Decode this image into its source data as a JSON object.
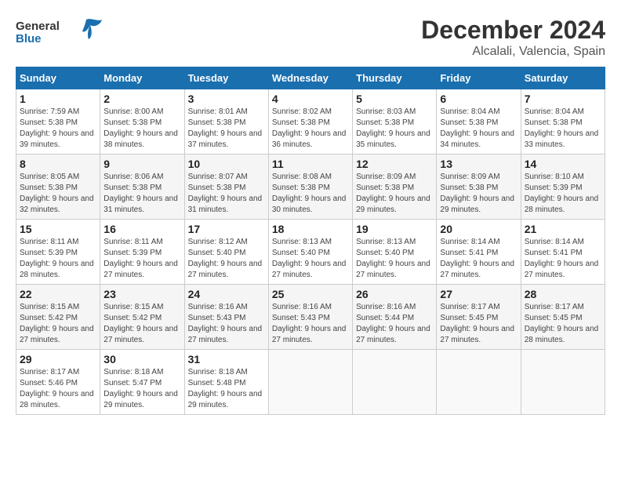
{
  "header": {
    "logo_general": "General",
    "logo_blue": "Blue",
    "month": "December 2024",
    "location": "Alcalali, Valencia, Spain"
  },
  "weekdays": [
    "Sunday",
    "Monday",
    "Tuesday",
    "Wednesday",
    "Thursday",
    "Friday",
    "Saturday"
  ],
  "weeks": [
    [
      {
        "day": "1",
        "sunrise": "7:59 AM",
        "sunset": "5:38 PM",
        "daylight": "9 hours and 39 minutes."
      },
      {
        "day": "2",
        "sunrise": "8:00 AM",
        "sunset": "5:38 PM",
        "daylight": "9 hours and 38 minutes."
      },
      {
        "day": "3",
        "sunrise": "8:01 AM",
        "sunset": "5:38 PM",
        "daylight": "9 hours and 37 minutes."
      },
      {
        "day": "4",
        "sunrise": "8:02 AM",
        "sunset": "5:38 PM",
        "daylight": "9 hours and 36 minutes."
      },
      {
        "day": "5",
        "sunrise": "8:03 AM",
        "sunset": "5:38 PM",
        "daylight": "9 hours and 35 minutes."
      },
      {
        "day": "6",
        "sunrise": "8:04 AM",
        "sunset": "5:38 PM",
        "daylight": "9 hours and 34 minutes."
      },
      {
        "day": "7",
        "sunrise": "8:04 AM",
        "sunset": "5:38 PM",
        "daylight": "9 hours and 33 minutes."
      }
    ],
    [
      {
        "day": "8",
        "sunrise": "8:05 AM",
        "sunset": "5:38 PM",
        "daylight": "9 hours and 32 minutes."
      },
      {
        "day": "9",
        "sunrise": "8:06 AM",
        "sunset": "5:38 PM",
        "daylight": "9 hours and 31 minutes."
      },
      {
        "day": "10",
        "sunrise": "8:07 AM",
        "sunset": "5:38 PM",
        "daylight": "9 hours and 31 minutes."
      },
      {
        "day": "11",
        "sunrise": "8:08 AM",
        "sunset": "5:38 PM",
        "daylight": "9 hours and 30 minutes."
      },
      {
        "day": "12",
        "sunrise": "8:09 AM",
        "sunset": "5:38 PM",
        "daylight": "9 hours and 29 minutes."
      },
      {
        "day": "13",
        "sunrise": "8:09 AM",
        "sunset": "5:38 PM",
        "daylight": "9 hours and 29 minutes."
      },
      {
        "day": "14",
        "sunrise": "8:10 AM",
        "sunset": "5:39 PM",
        "daylight": "9 hours and 28 minutes."
      }
    ],
    [
      {
        "day": "15",
        "sunrise": "8:11 AM",
        "sunset": "5:39 PM",
        "daylight": "9 hours and 28 minutes."
      },
      {
        "day": "16",
        "sunrise": "8:11 AM",
        "sunset": "5:39 PM",
        "daylight": "9 hours and 27 minutes."
      },
      {
        "day": "17",
        "sunrise": "8:12 AM",
        "sunset": "5:40 PM",
        "daylight": "9 hours and 27 minutes."
      },
      {
        "day": "18",
        "sunrise": "8:13 AM",
        "sunset": "5:40 PM",
        "daylight": "9 hours and 27 minutes."
      },
      {
        "day": "19",
        "sunrise": "8:13 AM",
        "sunset": "5:40 PM",
        "daylight": "9 hours and 27 minutes."
      },
      {
        "day": "20",
        "sunrise": "8:14 AM",
        "sunset": "5:41 PM",
        "daylight": "9 hours and 27 minutes."
      },
      {
        "day": "21",
        "sunrise": "8:14 AM",
        "sunset": "5:41 PM",
        "daylight": "9 hours and 27 minutes."
      }
    ],
    [
      {
        "day": "22",
        "sunrise": "8:15 AM",
        "sunset": "5:42 PM",
        "daylight": "9 hours and 27 minutes."
      },
      {
        "day": "23",
        "sunrise": "8:15 AM",
        "sunset": "5:42 PM",
        "daylight": "9 hours and 27 minutes."
      },
      {
        "day": "24",
        "sunrise": "8:16 AM",
        "sunset": "5:43 PM",
        "daylight": "9 hours and 27 minutes."
      },
      {
        "day": "25",
        "sunrise": "8:16 AM",
        "sunset": "5:43 PM",
        "daylight": "9 hours and 27 minutes."
      },
      {
        "day": "26",
        "sunrise": "8:16 AM",
        "sunset": "5:44 PM",
        "daylight": "9 hours and 27 minutes."
      },
      {
        "day": "27",
        "sunrise": "8:17 AM",
        "sunset": "5:45 PM",
        "daylight": "9 hours and 27 minutes."
      },
      {
        "day": "28",
        "sunrise": "8:17 AM",
        "sunset": "5:45 PM",
        "daylight": "9 hours and 28 minutes."
      }
    ],
    [
      {
        "day": "29",
        "sunrise": "8:17 AM",
        "sunset": "5:46 PM",
        "daylight": "9 hours and 28 minutes."
      },
      {
        "day": "30",
        "sunrise": "8:18 AM",
        "sunset": "5:47 PM",
        "daylight": "9 hours and 29 minutes."
      },
      {
        "day": "31",
        "sunrise": "8:18 AM",
        "sunset": "5:48 PM",
        "daylight": "9 hours and 29 minutes."
      },
      null,
      null,
      null,
      null
    ]
  ],
  "labels": {
    "sunrise": "Sunrise:",
    "sunset": "Sunset:",
    "daylight": "Daylight:"
  }
}
